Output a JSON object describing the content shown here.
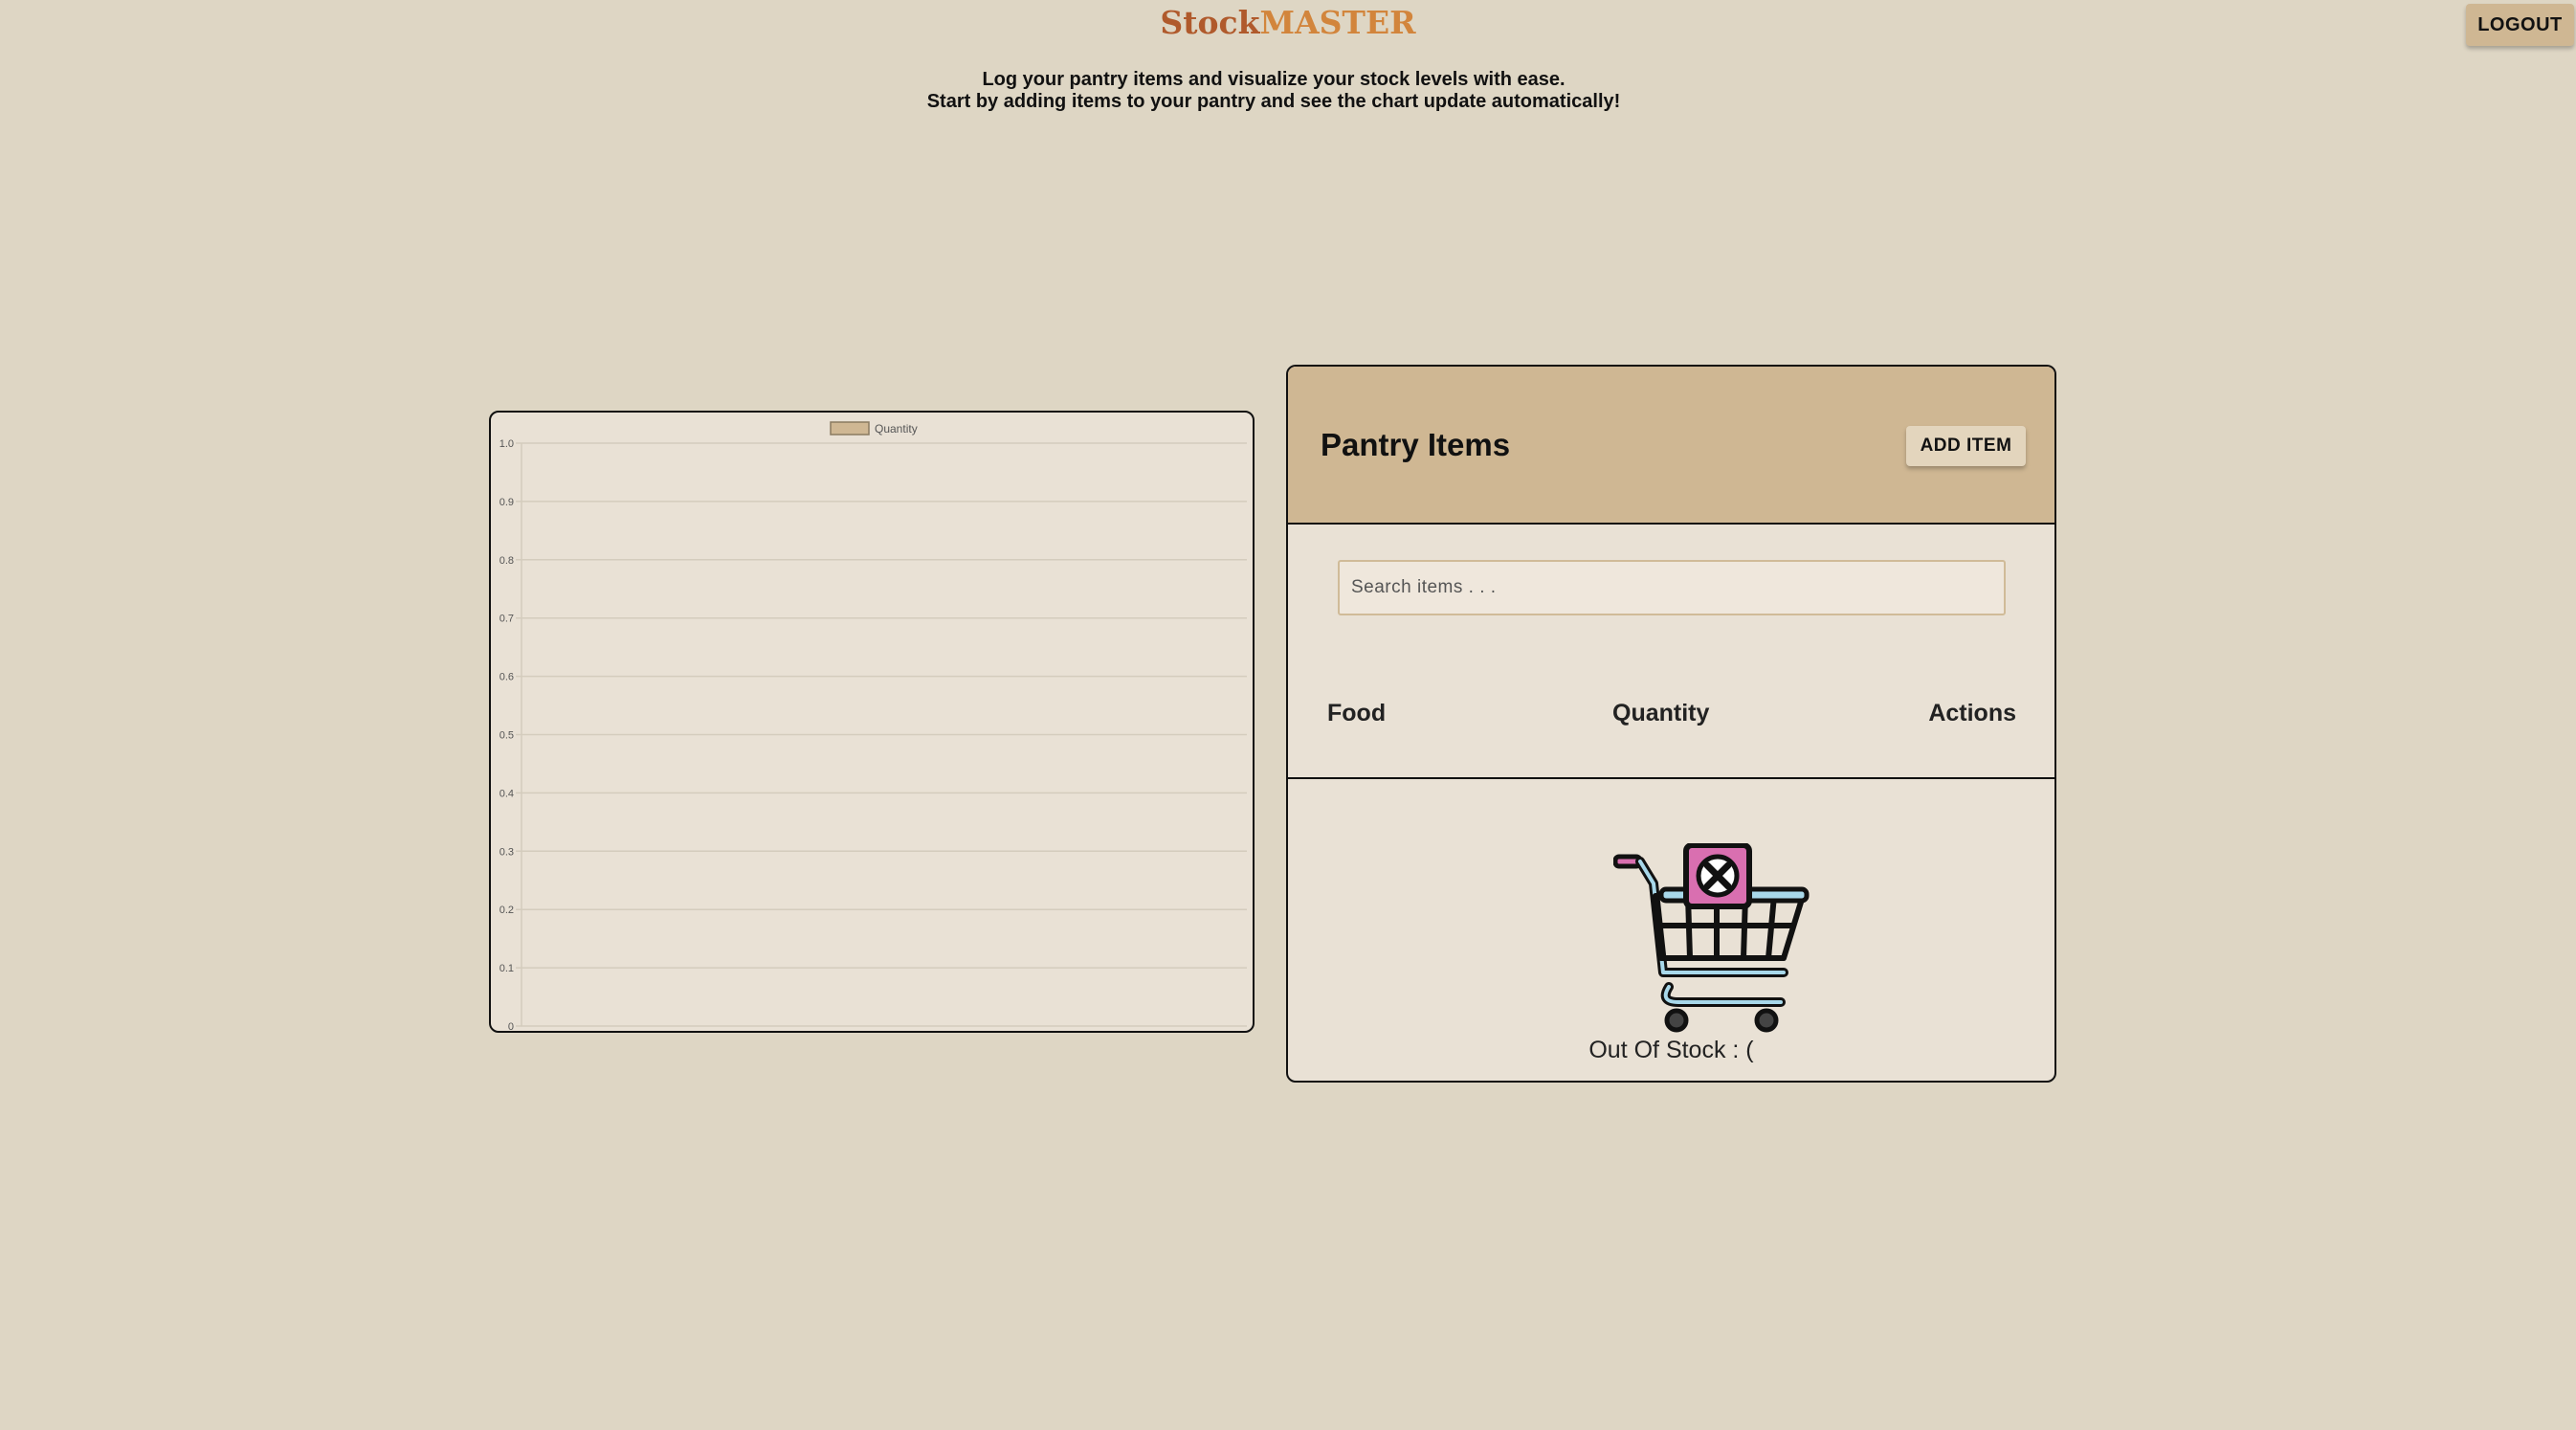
{
  "app": {
    "brand_part1": "Stock",
    "brand_part2": "MASTER",
    "logout_label": "LOGOUT"
  },
  "intro": {
    "line1": "Log your pantry items and visualize your stock levels with ease.",
    "line2": "Start by adding items to your pantry and see the chart update automatically!"
  },
  "chart_data": {
    "type": "bar",
    "categories": [],
    "series": [
      {
        "name": "Quantity",
        "values": [],
        "color": "#cfb793"
      }
    ],
    "legend_position": "top-center",
    "grid": true,
    "ylim": [
      0,
      1.0
    ],
    "yticks": [
      "0",
      "0.1",
      "0.2",
      "0.3",
      "0.4",
      "0.5",
      "0.6",
      "0.7",
      "0.8",
      "0.9",
      "1.0"
    ]
  },
  "pantry": {
    "title": "Pantry Items",
    "add_label": "ADD ITEM",
    "search_placeholder": "Search items . . .",
    "search_value": "",
    "columns": [
      "Food",
      "Quantity",
      "Actions"
    ],
    "rows": [],
    "empty_icon": "cart-out-of-stock-icon",
    "empty_message": "Out Of Stock : ("
  },
  "colors": {
    "background": "#ded6c4",
    "accent": "#cfb793",
    "brand_dark": "#b05a2c",
    "brand_light": "#d2853c",
    "icon_pink": "#d96fb0",
    "icon_blue": "#a8d8ea"
  }
}
